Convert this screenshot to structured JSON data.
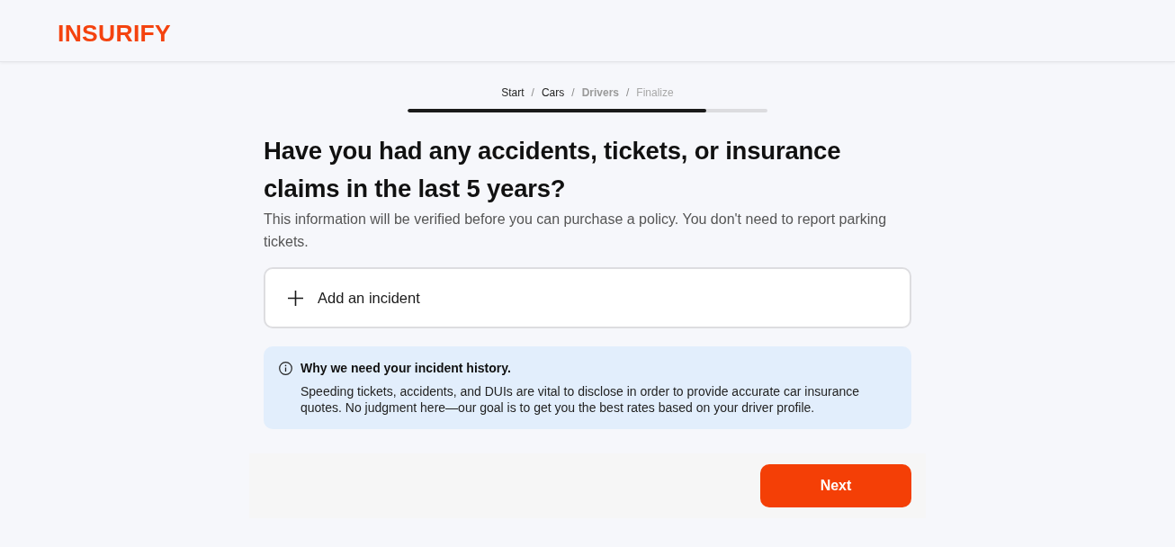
{
  "header": {
    "logo": "INSURIFY"
  },
  "breadcrumb": [
    {
      "kind": "step",
      "label": "Start",
      "completed": true,
      "current": false
    },
    {
      "kind": "separator",
      "label": "/"
    },
    {
      "kind": "step",
      "label": "Cars",
      "completed": true,
      "current": false
    },
    {
      "kind": "separator",
      "label": "/"
    },
    {
      "kind": "step",
      "label": "Drivers",
      "completed": false,
      "current": true
    },
    {
      "kind": "separator",
      "label": "/"
    },
    {
      "kind": "step",
      "label": "Finalize",
      "completed": false,
      "current": false
    }
  ],
  "progress": {
    "level": 0.83
  },
  "question": {
    "title": "Have you had any accidents, tickets, or insurance claims in the last 5 years?",
    "subtitle": "This information will be verified before you can purchase a policy. You don't need to report parking tickets."
  },
  "add_incident": {
    "label": "Add an incident"
  },
  "info": {
    "title": "Why we need your incident history.",
    "body": "Speeding tickets, accidents, and DUIs are vital to disclose in order to provide accurate car insurance quotes. No judgment here—our goal is to get you the best rates based on your driver profile."
  },
  "footer": {
    "next_button": "Next"
  }
}
